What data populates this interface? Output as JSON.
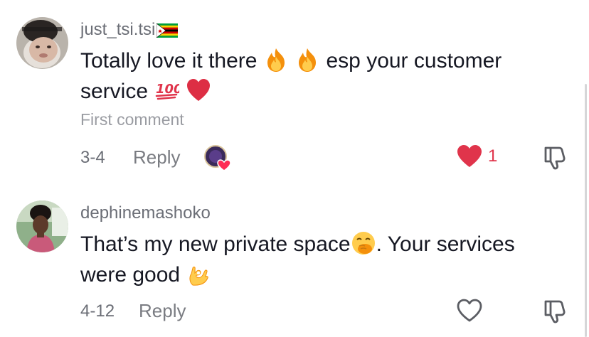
{
  "comments": [
    {
      "username": "just_tsi.tsi",
      "text_part1": "Totally love it there",
      "text_part2": "esp your customer",
      "text_part3": "service",
      "first_comment_label": "First comment",
      "date": "3-4",
      "reply_label": "Reply",
      "like_count": "1",
      "liked": true
    },
    {
      "username": "dephinemashoko",
      "text_part1": "That’s my new private space",
      "text_part2": ". Your services",
      "text_part3": "were good",
      "date": "4-12",
      "reply_label": "Reply",
      "liked": false
    }
  ],
  "colors": {
    "like_red": "#e0344b",
    "muted_text": "#6b6e76",
    "body_text": "#161823"
  },
  "icons": [
    "zimbabwe-flag-icon",
    "fire-icon",
    "hundred-points-icon",
    "red-heart-icon",
    "face-with-hand-over-mouth-icon",
    "ok-hand-icon",
    "heart-icon",
    "dislike-icon"
  ]
}
